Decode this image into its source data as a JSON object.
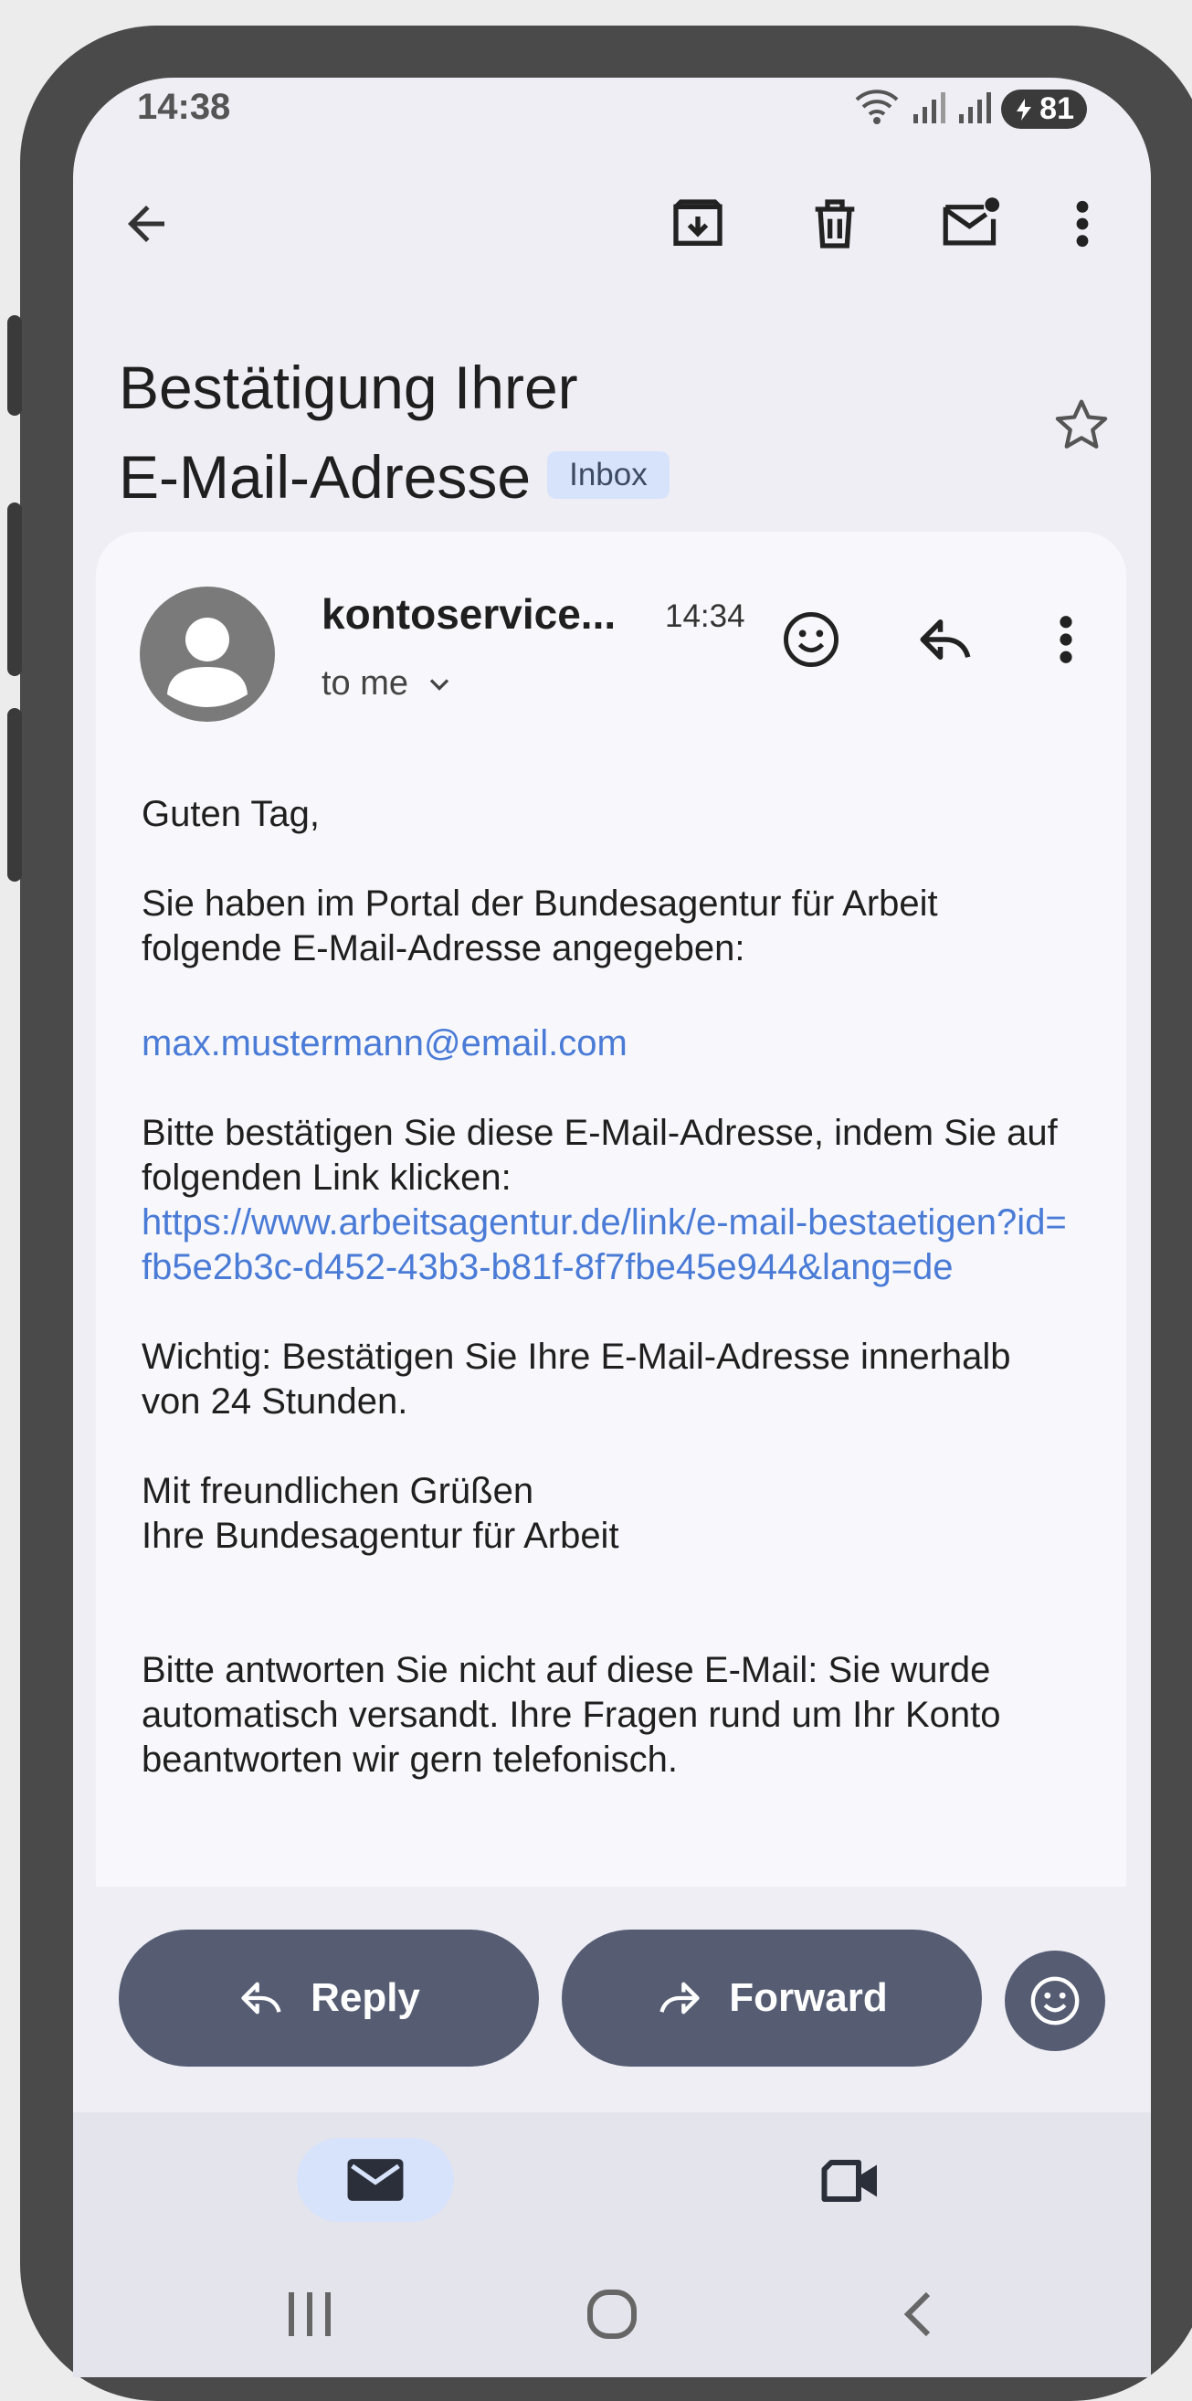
{
  "status_bar": {
    "time": "14:38",
    "battery": "81",
    "icons": [
      "wifi-icon",
      "signal-icon",
      "signal-icon",
      "battery-icon"
    ]
  },
  "toolbar": {
    "icons": [
      "back-arrow-icon",
      "archive-icon",
      "delete-icon",
      "mark-unread-icon",
      "more-vert-icon"
    ]
  },
  "email": {
    "subject_line1": "Bestätigung Ihrer",
    "subject_line2": "E-Mail-Adresse",
    "label": "Inbox",
    "sender": "kontoservice...",
    "time": "14:34",
    "recipient": "to me",
    "body": {
      "greeting": "Guten Tag,",
      "para1": "Sie haben im Portal der Bundesagentur für Arbeit folgende E-Mail-Adresse angegeben:",
      "email_address": "max.mustermann@email.com",
      "para2": "Bitte bestätigen Sie diese E-Mail-Adresse, indem Sie auf folgenden Link klicken:",
      "link": "https://www.arbeitsagentur.de/link/e-mail-bestaetigen?id=fb5e2b3c-d452-43b3-b81f-8f7fbe45e944&lang=de",
      "important": "Wichtig: Bestätigen Sie Ihre E-Mail-Adresse innerhalb von 24 Stunden.",
      "closing1": "Mit freundlichen Grüßen",
      "closing2": "Ihre Bundesagentur für Arbeit",
      "footer": "Bitte antworten Sie nicht auf diese E-Mail: Sie wurde automatisch versandt. Ihre Fragen rund um Ihr Konto beantworten wir gern telefonisch."
    }
  },
  "actions": {
    "reply_label": "Reply",
    "forward_label": "Forward"
  },
  "colors": {
    "accent_link": "#4a7bd6",
    "action_button": "#565d73",
    "chip_background": "#d7e3fa"
  }
}
